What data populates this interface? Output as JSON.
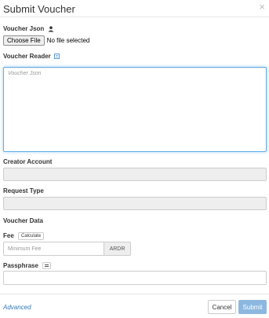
{
  "modal": {
    "title": "Submit Voucher",
    "close_glyph": "×"
  },
  "voucher_json": {
    "label": "Voucher Json",
    "icon": "upload-user-icon",
    "choose_button": "Choose File",
    "file_status": "No file selected"
  },
  "voucher_reader": {
    "label": "Voucher Reader",
    "icon": "qr-reader-icon",
    "placeholder": "Voucher Json"
  },
  "creator_account": {
    "label": "Creator Account",
    "value": ""
  },
  "request_type": {
    "label": "Request Type",
    "value": ""
  },
  "voucher_data": {
    "label": "Voucher Data"
  },
  "fee": {
    "label": "Fee",
    "calculate_button": "Calculate",
    "placeholder": "Minimum Fee",
    "currency": "ARDR"
  },
  "passphrase": {
    "label": "Passphrase",
    "icon": "keyboard-icon",
    "value": ""
  },
  "footer": {
    "advanced_link": "Advanced",
    "cancel_button": "Cancel",
    "submit_button": "Submit"
  },
  "colors": {
    "link": "#337ab7",
    "submit_disabled": "#8cb8e0",
    "focus_border": "#66afe9",
    "disabled_field": "#eeeeee"
  }
}
